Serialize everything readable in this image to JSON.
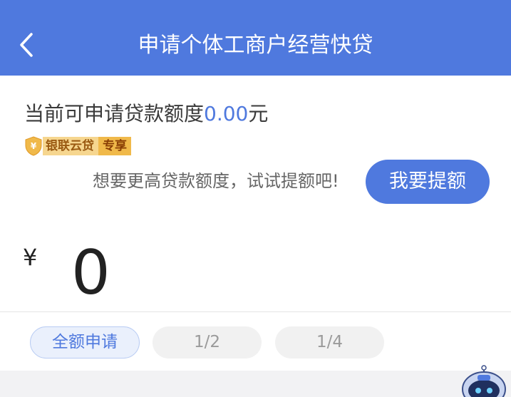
{
  "header": {
    "title": "申请个体工商户经营快贷",
    "back_icon": "chevron-left-icon"
  },
  "quota": {
    "prefix": "当前可申请贷款额度",
    "amount": "0.00",
    "unit": "元"
  },
  "badge": {
    "icon": "shield-yen-icon",
    "brand": "银联云贷",
    "tag": "专享"
  },
  "raise": {
    "hint": "想要更高贷款额度，试试提额吧!",
    "button_label": "我要提额"
  },
  "amount_input": {
    "currency_symbol": "¥",
    "value": "0"
  },
  "ratio_options": [
    {
      "label": "全额申请",
      "selected": true
    },
    {
      "label": "1/2",
      "selected": false
    },
    {
      "label": "1/4",
      "selected": false
    }
  ],
  "assistant": {
    "icon": "robot-assistant-icon"
  },
  "colors": {
    "primary": "#4f79de",
    "badge_bg": "#f6d68f",
    "badge_tag_bg": "#f0b94a"
  }
}
